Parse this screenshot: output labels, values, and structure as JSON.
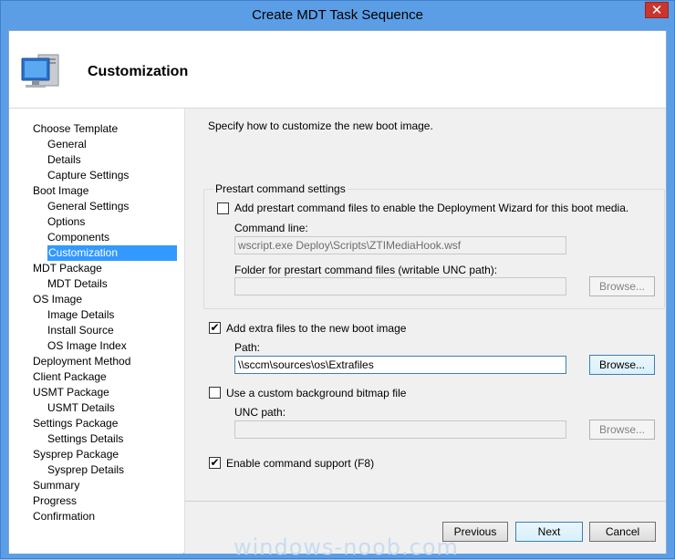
{
  "window": {
    "title": "Create MDT Task Sequence",
    "close_glyph": "✕"
  },
  "header": {
    "title": "Customization",
    "icon": "computer-icon"
  },
  "nav": {
    "items": [
      {
        "label": "Choose Template",
        "indent": 0
      },
      {
        "label": "General",
        "indent": 1
      },
      {
        "label": "Details",
        "indent": 1
      },
      {
        "label": "Capture Settings",
        "indent": 1
      },
      {
        "label": "Boot Image",
        "indent": 0
      },
      {
        "label": "General Settings",
        "indent": 1
      },
      {
        "label": "Options",
        "indent": 1
      },
      {
        "label": "Components",
        "indent": 1
      },
      {
        "label": "Customization",
        "indent": 1,
        "selected": true
      },
      {
        "label": "MDT Package",
        "indent": 0
      },
      {
        "label": "MDT Details",
        "indent": 1
      },
      {
        "label": "OS Image",
        "indent": 0
      },
      {
        "label": "Image Details",
        "indent": 1
      },
      {
        "label": "Install Source",
        "indent": 1
      },
      {
        "label": "OS Image Index",
        "indent": 1
      },
      {
        "label": "Deployment Method",
        "indent": 0
      },
      {
        "label": "Client Package",
        "indent": 0
      },
      {
        "label": "USMT Package",
        "indent": 0
      },
      {
        "label": "USMT Details",
        "indent": 1
      },
      {
        "label": "Settings Package",
        "indent": 0
      },
      {
        "label": "Settings Details",
        "indent": 1
      },
      {
        "label": "Sysprep Package",
        "indent": 0
      },
      {
        "label": "Sysprep Details",
        "indent": 1
      },
      {
        "label": "Summary",
        "indent": 0
      },
      {
        "label": "Progress",
        "indent": 0
      },
      {
        "label": "Confirmation",
        "indent": 0
      }
    ]
  },
  "content": {
    "intro": "Specify how to customize the new boot image.",
    "prestart": {
      "legend": "Prestart command settings",
      "checkbox_label": "Add prestart command files to enable the Deployment Wizard for this boot media.",
      "checked": false,
      "command_line_label": "Command line:",
      "command_line_value": "wscript.exe Deploy\\Scripts\\ZTIMediaHook.wsf",
      "folder_label": "Folder for prestart command files (writable UNC path):",
      "folder_value": "",
      "browse_label": "Browse..."
    },
    "extra_files": {
      "checkbox_label": "Add extra files to the new boot image",
      "checked": true,
      "check_glyph": "✔",
      "path_label": "Path:",
      "path_value": "\\\\sccm\\sources\\os\\Extrafiles",
      "browse_label": "Browse..."
    },
    "background": {
      "checkbox_label": "Use a custom background bitmap file",
      "checked": false,
      "unc_label": "UNC path:",
      "unc_value": "",
      "browse_label": "Browse..."
    },
    "command_support": {
      "checkbox_label": "Enable command support (F8)",
      "checked": true,
      "check_glyph": "✔"
    }
  },
  "footer": {
    "previous": "Previous",
    "next": "Next",
    "cancel": "Cancel"
  },
  "watermark": "windows-noob.com"
}
